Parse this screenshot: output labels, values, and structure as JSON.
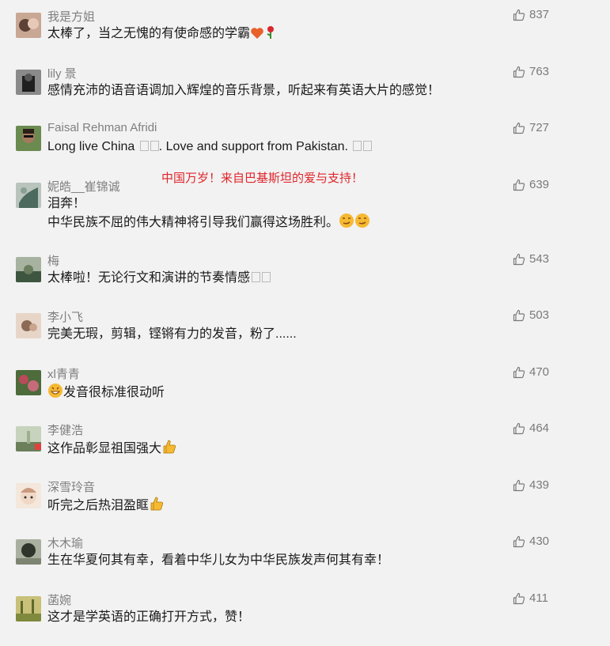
{
  "translation_note": "中国万岁！来自巴基斯坦的爱与支持！",
  "comments": [
    {
      "name": "我是方姐",
      "text": "太棒了，当之无愧的有使命感的学霸",
      "likes": "837",
      "avatar_colors": [
        "#b98f7a",
        "#5d4134"
      ]
    },
    {
      "name": "lily 景",
      "text": "感情充沛的语音语调加入辉煌的音乐背景，听起来有英语大片的感觉！",
      "likes": "763",
      "avatar_colors": [
        "#6b6b6b",
        "#1f1f1f"
      ]
    },
    {
      "name": "Faisal Rehman Afridi",
      "text": "Long live China",
      "text_mid": ". Love and support from Pakistan.",
      "likes": "727",
      "avatar_colors": [
        "#6a8a4f",
        "#3b2a22"
      ]
    },
    {
      "name": "妮皓__崔锦诚",
      "text": "泪奔！",
      "text2": "中华民族不屈的伟大精神将引导我们赢得这场胜利。",
      "likes": "639",
      "avatar_colors": [
        "#9fb0a6",
        "#4c6a5e"
      ]
    },
    {
      "name": "梅",
      "text": "太棒啦！无论行文和演讲的节奏情感",
      "likes": "543",
      "avatar_colors": [
        "#8d9b78",
        "#3e5640"
      ]
    },
    {
      "name": "李小飞",
      "text": "完美无瑕，剪辑，铿锵有力的发音，粉了......",
      "likes": "503",
      "avatar_colors": [
        "#d9c3b3",
        "#8c6a55"
      ]
    },
    {
      "name": "xl青青",
      "text": "发音很标准很动听",
      "likes": "470",
      "avatar_colors": [
        "#b94a5a",
        "#4d6b3b"
      ]
    },
    {
      "name": "李健浩",
      "text": "这作品彰显祖国强大",
      "likes": "464",
      "avatar_colors": [
        "#9db08c",
        "#6b7f5a"
      ]
    },
    {
      "name": "深雪玲音",
      "text": "听完之后热泪盈眶",
      "likes": "439",
      "avatar_colors": [
        "#f1d8c6",
        "#c99a80"
      ]
    },
    {
      "name": "木木瑜",
      "text": "生在华夏何其有幸，看着中华儿女为中华民族发声何其有幸！",
      "likes": "430",
      "avatar_colors": [
        "#7d8572",
        "#2f352a"
      ]
    },
    {
      "name": "菡婉",
      "text": "这才是学英语的正确打开方式，赞！",
      "likes": "411",
      "avatar_colors": [
        "#b8b46a",
        "#5d6a2a"
      ]
    }
  ],
  "colors": {
    "background": "#f2f2f2",
    "name": "#7f7f7f",
    "text": "#1a1a1a",
    "likes": "#7a7a7a",
    "translation": "#e0252b"
  },
  "icons": {
    "like": "thumbs-up-icon"
  }
}
